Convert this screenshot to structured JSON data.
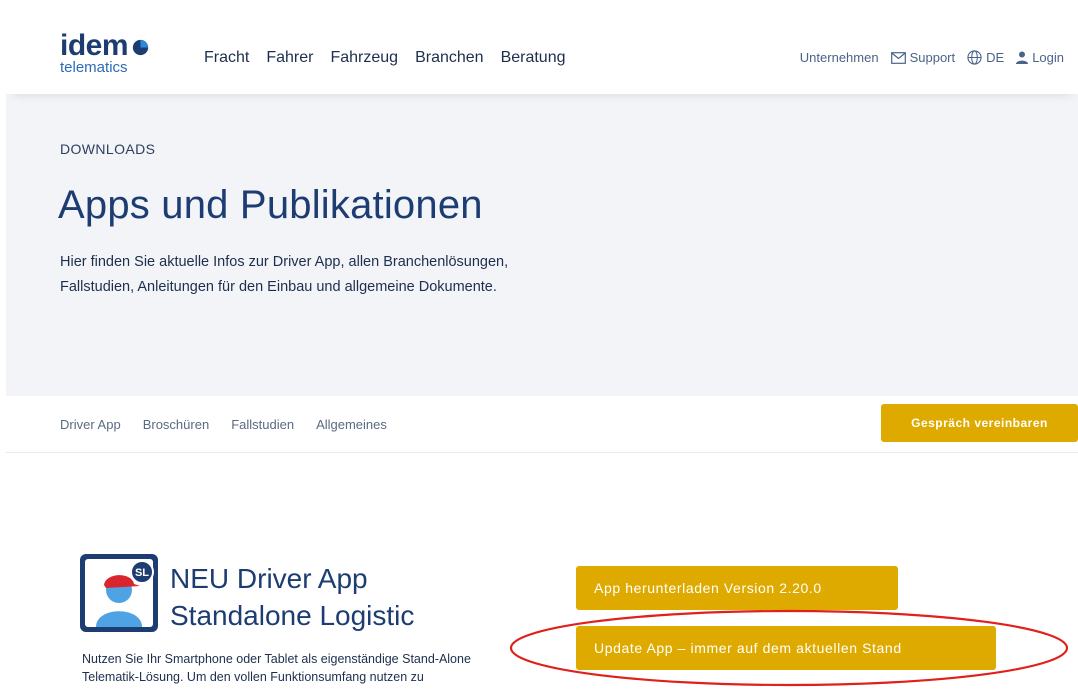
{
  "logo": {
    "main": "idem",
    "sub": "telematics"
  },
  "nav": [
    "Fracht",
    "Fahrer",
    "Fahrzeug",
    "Branchen",
    "Beratung"
  ],
  "utils": {
    "company": "Unternehmen",
    "support": "Support",
    "language": "DE",
    "login": "Login"
  },
  "hero": {
    "eyebrow": "DOWNLOADS",
    "title": "Apps und Publikationen",
    "description": "Hier finden Sie aktuelle Infos zur Driver App, allen Branchenlösungen, Fallstudien, Anleitungen für den Einbau und allgemeine Dokumente."
  },
  "subnav": {
    "items": [
      "Driver App",
      "Broschüren",
      "Fallstudien",
      "Allgemeines"
    ],
    "cta": "Gespräch vereinbaren"
  },
  "app": {
    "icon_badge": "SL",
    "title_line1": "NEU Driver App",
    "title_line2": "Standalone Logistic",
    "description": "Nutzen Sie Ihr Smartphone oder Tablet als eigenständige Stand-Alone Telematik-Lösung. Um den vollen Funktionsumfang nutzen zu",
    "download_button": "App herunterladen Version 2.20.0",
    "update_button": "Update App – immer auf dem aktuellen Stand"
  },
  "colors": {
    "brand_navy": "#1d3d72",
    "brand_blue": "#2a6cb5",
    "accent_gold": "#dfaa00",
    "hero_bg": "#f2f4f7",
    "annotation_red": "#e0201b"
  }
}
